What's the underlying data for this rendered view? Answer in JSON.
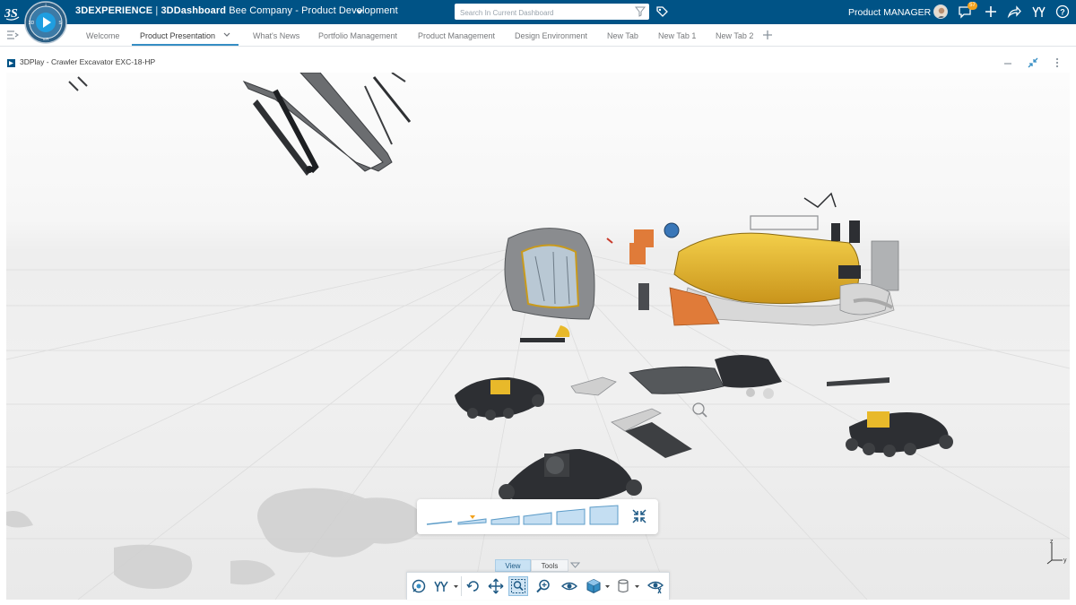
{
  "header": {
    "brand": "3DEXPERIENCE",
    "app": "3DDashboard",
    "context": "Bee Company - Product Development",
    "search_placeholder": "Search In Current Dashboard",
    "user": "Product MANAGER",
    "notification_count": "57",
    "icons": [
      "ds-logo-icon",
      "compass-icon",
      "chevron-down-icon",
      "filter-icon",
      "tag-icon",
      "avatar",
      "chat-icon",
      "plus-icon",
      "share-icon",
      "collaborate-icon",
      "help-icon"
    ]
  },
  "tabs": [
    {
      "label": "Welcome",
      "active": false
    },
    {
      "label": "Product Presentation",
      "active": true
    },
    {
      "label": "What's News",
      "active": false
    },
    {
      "label": "Portfolio Management",
      "active": false
    },
    {
      "label": "Product Management",
      "active": false
    },
    {
      "label": "Design Environment",
      "active": false
    },
    {
      "label": "New Tab",
      "active": false
    },
    {
      "label": "New Tab 1",
      "active": false
    },
    {
      "label": "New Tab 2",
      "active": false
    }
  ],
  "widget": {
    "title": "3DPlay - Crawler Excavator EXC-18-HP",
    "icons": [
      "minimize-icon",
      "collapse-arrows-icon",
      "more-options-icon"
    ]
  },
  "viewer": {
    "timeline_steps": 6,
    "timeline_marker_step": 2,
    "axis_labels": {
      "z": "z",
      "y": "y"
    },
    "section_tabs": [
      {
        "label": "View",
        "active": true
      },
      {
        "label": "Tools",
        "active": false
      }
    ],
    "action_bar": [
      "view-mode-icon",
      "measure-icon",
      "rotate-icon",
      "pan-icon",
      "zoom-area-icon",
      "zoom-icon",
      "look-icon",
      "cube-view-icon",
      "render-style-icon",
      "visibility-icon"
    ]
  },
  "colors": {
    "topbar": "#005386",
    "accent": "#368ec4",
    "excavator_yellow": "#e8b92a",
    "part_dark": "#2d2f33",
    "part_orange": "#e07b39"
  }
}
